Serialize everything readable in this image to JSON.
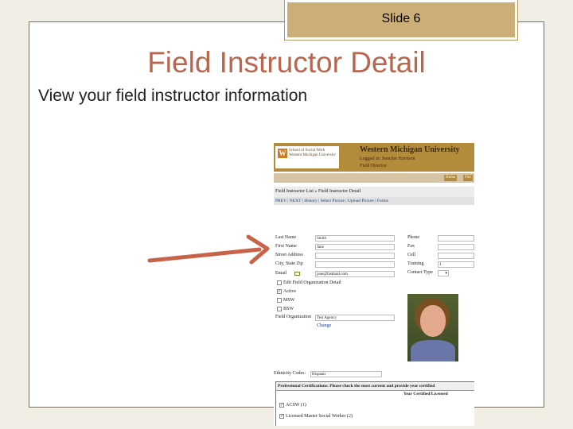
{
  "slide": {
    "number_label": "Slide 6",
    "title": "Field Instructor Detail",
    "subtitle": "View your field instructor information"
  },
  "app": {
    "logo_mark": "W",
    "logo_text_1": "School of Social Work",
    "logo_text_2": "Western Michigan University",
    "university": "Western Michigan University",
    "logged_in": "Logged in: Jennifer Harrison",
    "role": "Field Director",
    "nav_buttons": [
      "Home",
      "Fiel"
    ],
    "breadcrumb": "Field Instructor List  »  Field Instructor Detail",
    "action_links": "PREV | NEXT | History | Select Picture | Upload Picture | Forms"
  },
  "form": {
    "left_labels": [
      "Last Name",
      "First Name",
      "Street Address",
      "City, State Zip",
      "Email"
    ],
    "last_name_value": "Smith",
    "first_name_value": "Jane",
    "email_value": "jane@fastmail.com",
    "right_labels": [
      "Phone",
      "Fax",
      "Cell",
      "Training",
      "Contact Type"
    ],
    "training_value": "1",
    "checkboxes": [
      {
        "label": "Edit Field Organization Detail",
        "checked": false
      },
      {
        "label": "Active",
        "checked": true
      },
      {
        "label": "MSW",
        "checked": false
      },
      {
        "label": "BSW",
        "checked": false
      }
    ],
    "field_org_label": "Field Organization",
    "field_org_value": "Test Agency",
    "change_link": "Change",
    "ethnicity_label": "Ethnicity Codes:",
    "ethnicity_value": "Hispanic"
  },
  "certifications": {
    "header": "Professional Certifications: Please check the most current and provide year certified",
    "column": "Year Certified/Licensed",
    "items": [
      "ACSW (1)",
      "Licensed Master Social Worker (2)"
    ]
  },
  "colors": {
    "accent_title": "#b8664e",
    "tab_gold": "#cbae78",
    "header_brown": "#b28b3b",
    "arrow": "#c8634a"
  }
}
